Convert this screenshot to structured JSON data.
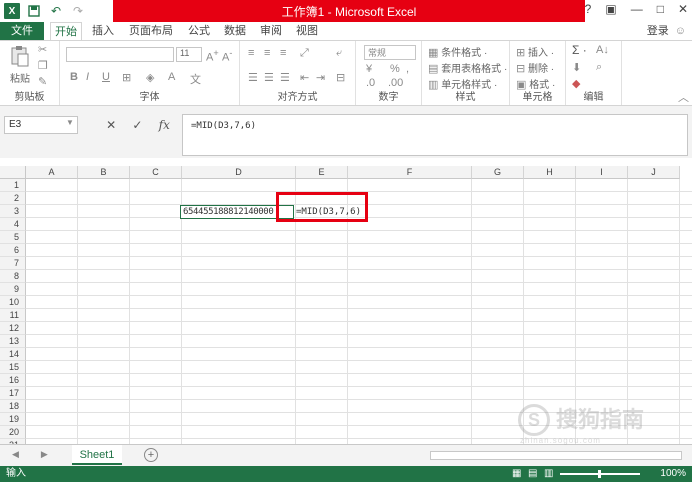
{
  "window": {
    "title": "工作簿1 - Microsoft Excel",
    "qat_undo": "↶",
    "qat_redo": "↷"
  },
  "tabs": [
    {
      "label": "文件"
    },
    {
      "label": "开始"
    },
    {
      "label": "插入"
    },
    {
      "label": "页面布局"
    },
    {
      "label": "公式"
    },
    {
      "label": "数据"
    },
    {
      "label": "审阅"
    },
    {
      "label": "视图"
    }
  ],
  "account": {
    "login": "登录"
  },
  "ribbon": {
    "clipboard": {
      "label": "剪贴板",
      "paste": "粘贴"
    },
    "font": {
      "label": "字体",
      "size": "11",
      "bold": "B",
      "italic": "I",
      "underline": "U"
    },
    "alignment": {
      "label": "对齐方式"
    },
    "number": {
      "label": "数字",
      "format": "常规",
      "percent": "%"
    },
    "styles": {
      "label": "样式",
      "conditional": "条件格式 ·",
      "table": "套用表格格式 ·",
      "cell": "单元格样式 ·"
    },
    "cells": {
      "label": "单元格",
      "insert": "插入 ·",
      "delete": "删除 ·",
      "format": "格式 ·"
    },
    "editing": {
      "label": "编辑",
      "sum": "Σ ·"
    }
  },
  "formula_bar": {
    "name_box": "E3",
    "formula": "=MID(D3,7,6)",
    "fx": "fx"
  },
  "grid": {
    "columns": [
      "A",
      "B",
      "C",
      "D",
      "E",
      "F",
      "G",
      "H",
      "I",
      "J"
    ],
    "rows": [
      "1",
      "2",
      "3",
      "4",
      "5",
      "6",
      "7",
      "8",
      "9",
      "10",
      "11",
      "12",
      "13",
      "14",
      "15",
      "16",
      "17",
      "18",
      "19",
      "20",
      "21"
    ],
    "cells": {
      "D3": "654455188812140000",
      "E3": "=MID(D3,7,6)"
    }
  },
  "sheets": {
    "active": "Sheet1",
    "add": "+"
  },
  "status": {
    "mode": "输入",
    "zoom": "100%"
  },
  "watermark": {
    "brand": "搜狗指南",
    "url": "zhinan.sogou.com",
    "glyph": "S"
  },
  "colors": {
    "accent": "#217346",
    "title_highlight": "#e60012",
    "annotation": "#e60012"
  }
}
